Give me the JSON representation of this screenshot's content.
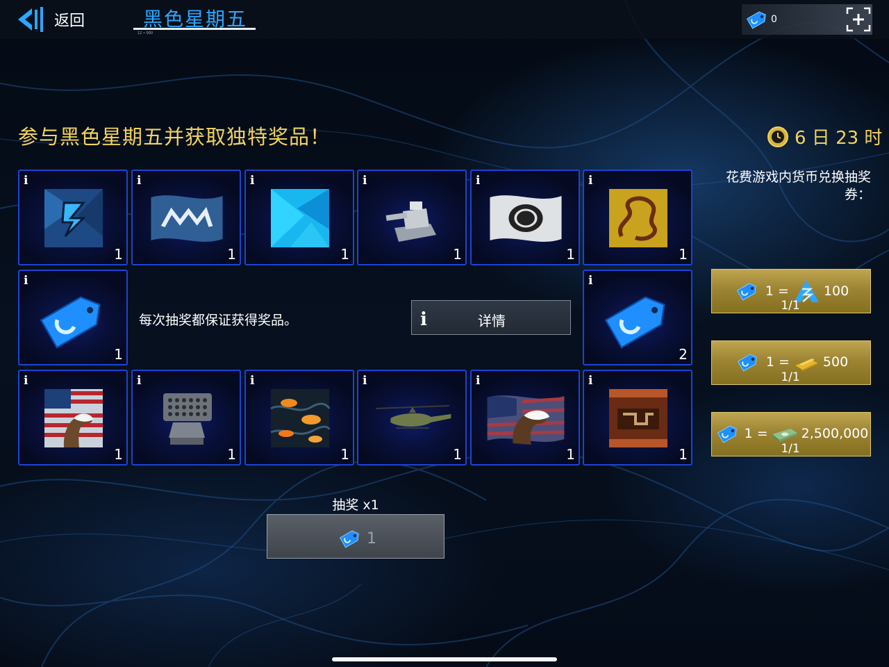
{
  "app": {
    "accent": "#29a8ff",
    "gold": "#f2d35c",
    "cell_border": "#1b43d6"
  },
  "header": {
    "back_label": "返回",
    "back_icon": "back-logo-icon",
    "event_tab_title": "黑色星期五",
    "event_tab_subtitle": "12 • 000",
    "wallet": {
      "icon": "ticket-icon",
      "count": "0",
      "add_icon": "plus-icon"
    }
  },
  "main": {
    "headline": "参与黑色星期五并获取独特奖品！",
    "timer": {
      "icon": "clock-icon",
      "text": "6 日 23 时"
    },
    "guarantee_text": "每次抽奖都保证获得奖品。",
    "details_button": {
      "icon": "info-icon",
      "label": "详情"
    },
    "draw": {
      "label": "抽奖 x1",
      "cost": "1",
      "cost_icon": "ticket-icon"
    }
  },
  "prizes": {
    "info_glyph": "i",
    "items": [
      {
        "name": "sigil-logo-camo",
        "qty": "1"
      },
      {
        "name": "flag-mw-blue",
        "qty": "1"
      },
      {
        "name": "camo-cyan",
        "qty": "1"
      },
      {
        "name": "turret-module",
        "qty": "1"
      },
      {
        "name": "flag-white-emblem",
        "qty": "1"
      },
      {
        "name": "camo-gold-dragon",
        "qty": "1"
      },
      {
        "name": "lottery-ticket",
        "qty": "1"
      },
      {
        "name": "lottery-ticket",
        "qty": "2"
      },
      {
        "name": "camo-eagle-flag",
        "qty": "1"
      },
      {
        "name": "rocket-launcher-module",
        "qty": "1"
      },
      {
        "name": "camo-koi",
        "qty": "1"
      },
      {
        "name": "helicopter",
        "qty": "1"
      },
      {
        "name": "flag-eagle",
        "qty": "1"
      },
      {
        "name": "camo-aztec",
        "qty": "1"
      }
    ]
  },
  "exchange": {
    "title": "花费游戏内货币兑换抽奖券：",
    "offers": [
      {
        "lhs": "1 =",
        "currency_icon": "premium-currency-icon",
        "amount": "100",
        "limit": "1/1"
      },
      {
        "lhs": "1 =",
        "currency_icon": "gold-bar-icon",
        "amount": "500",
        "limit": "1/1"
      },
      {
        "lhs": "1 =",
        "currency_icon": "cash-icon",
        "amount": "2,500,000",
        "limit": "1/1"
      }
    ]
  }
}
